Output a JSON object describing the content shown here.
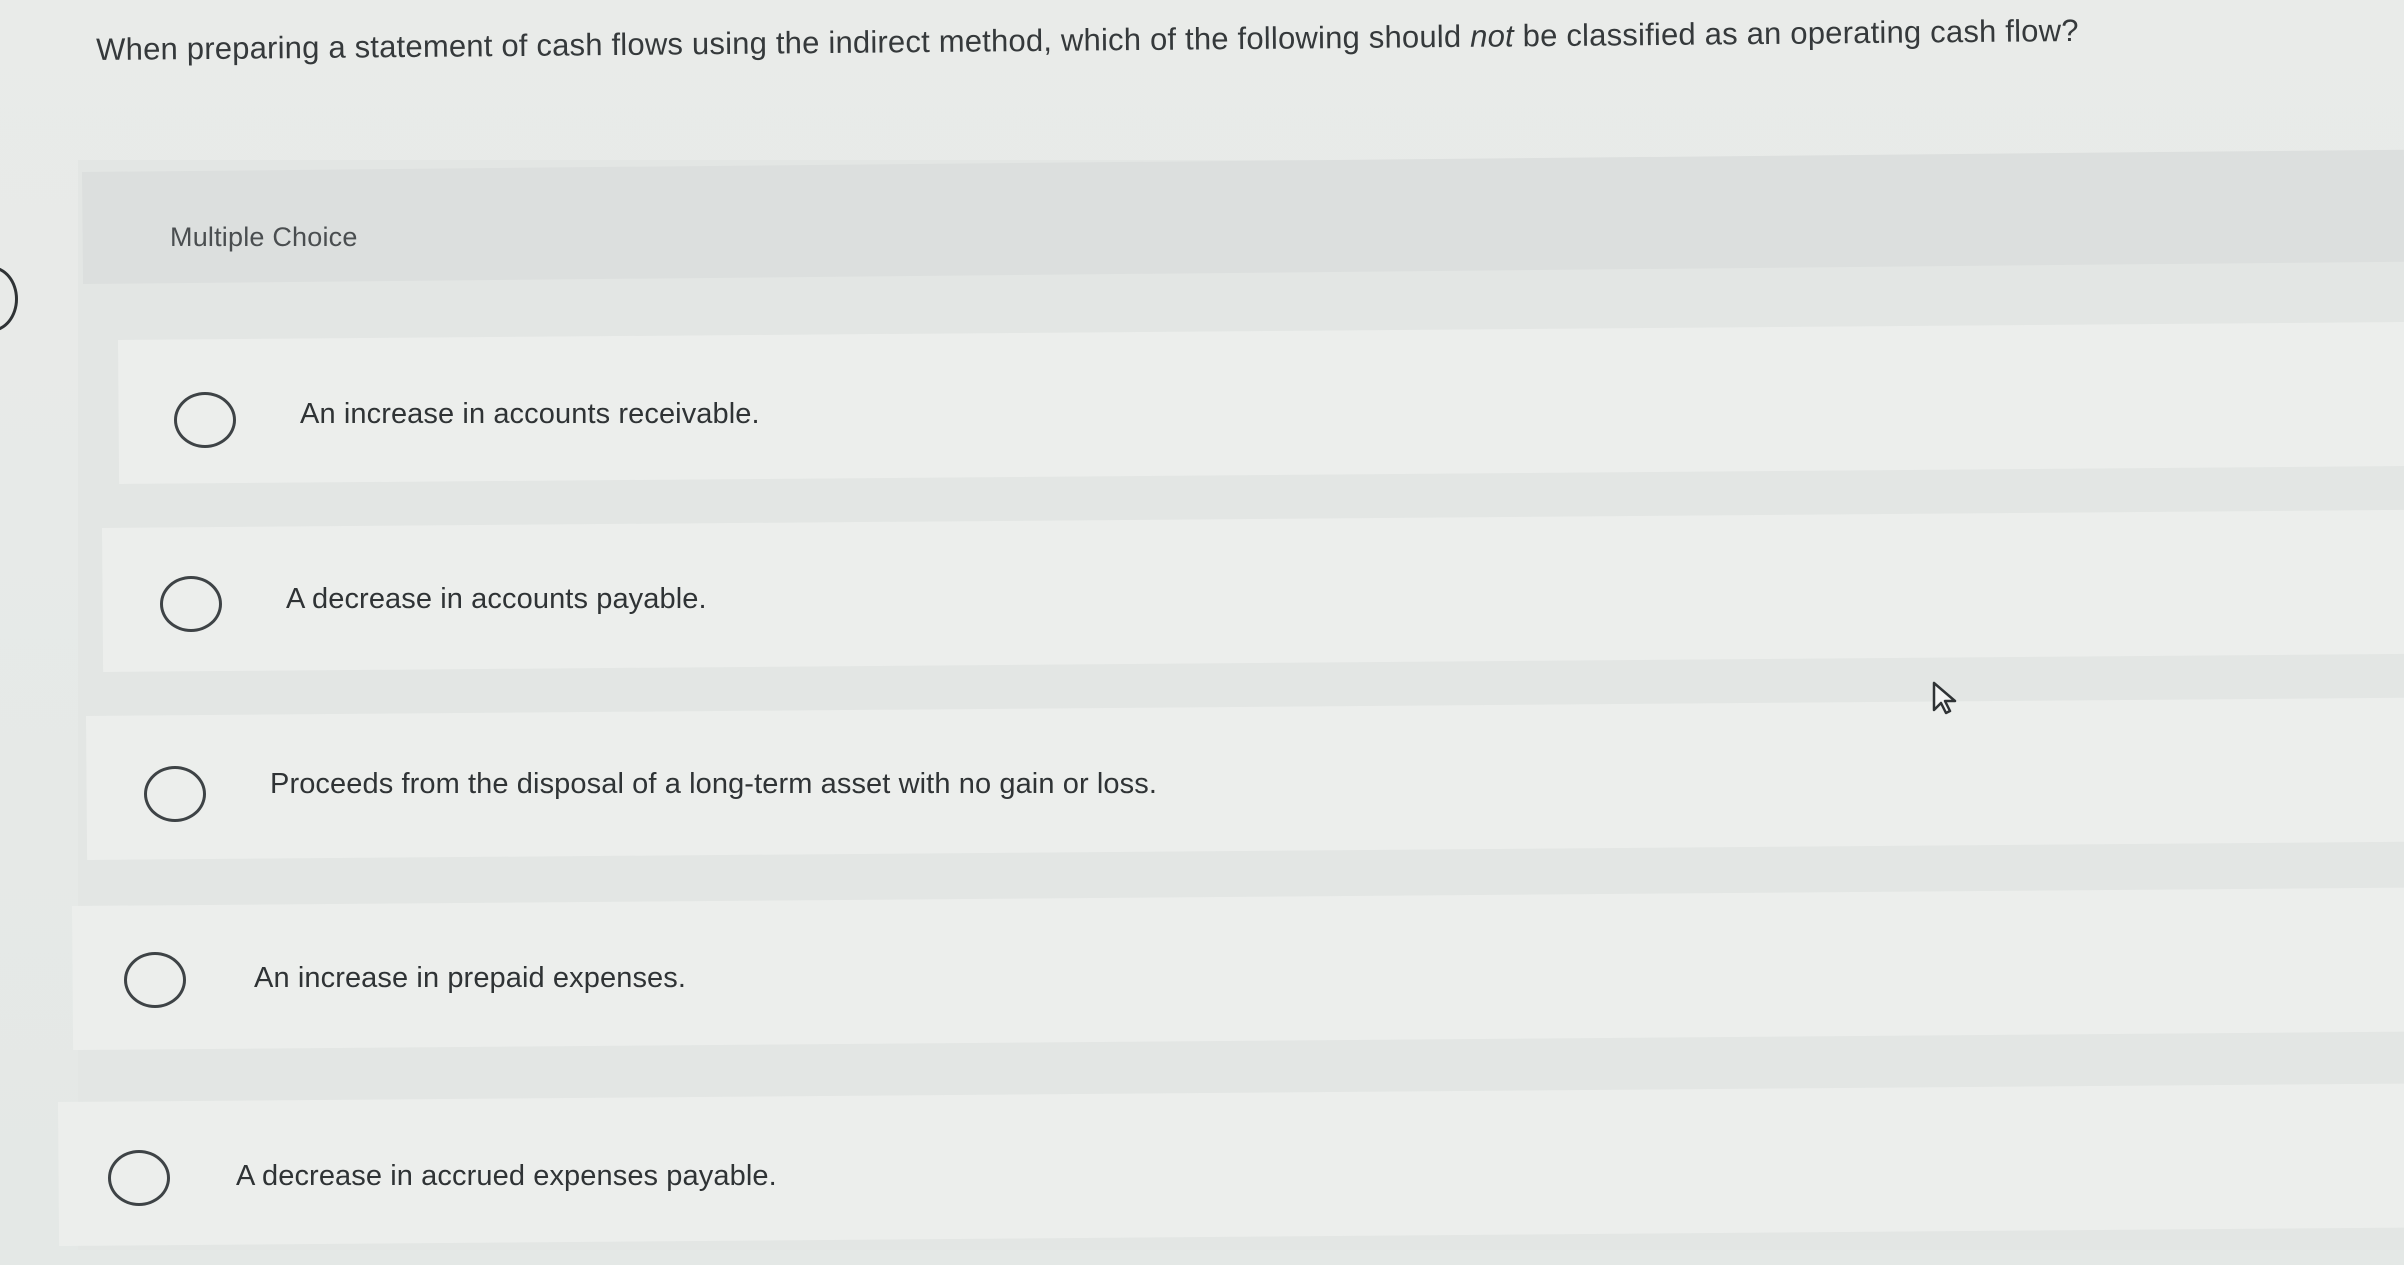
{
  "question": {
    "text_before": "When preparing a statement of cash flows using the indirect method, which of the following should ",
    "emphasis": "not",
    "text_after": " be classified as an operating cash flow?"
  },
  "multiple_choice": {
    "header_label": "Multiple Choice",
    "options": [
      {
        "label": "An increase in accounts receivable."
      },
      {
        "label": "A decrease in accounts payable."
      },
      {
        "label": "Proceeds from the disposal of a long-term asset with no gain or loss."
      },
      {
        "label": "An increase in prepaid expenses."
      },
      {
        "label": "A decrease in accrued expenses payable."
      }
    ]
  },
  "icons": {
    "cursor": "mouse-pointer-icon",
    "radio": "radio-unselected-icon"
  },
  "colors": {
    "page_background": "#e6e9e6",
    "header_band": "#dcdfde",
    "option_band": "#eceeec",
    "text": "#2f3335"
  }
}
